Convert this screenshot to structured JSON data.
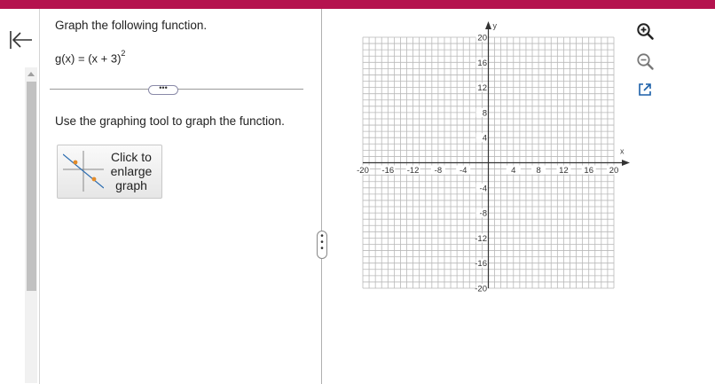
{
  "colors": {
    "topbar": "#b5124e",
    "accent": "#1a5fa8",
    "grid": "#b9b9b9",
    "axis": "#333333"
  },
  "question": {
    "title": "Graph the following function.",
    "function_lhs": "g(x) = (x + 3)",
    "function_exponent": "2",
    "instruction": "Use the graphing tool to graph the function.",
    "more_label": "•••",
    "enlarge_label_lines": [
      "Click to",
      "enlarge",
      "graph"
    ]
  },
  "graph": {
    "x_axis_label": "x",
    "y_axis_label": "y",
    "x_range": [
      -20,
      20
    ],
    "y_range": [
      -20,
      20
    ],
    "grid_step": 1,
    "x_tick_labels": [
      "-20",
      "-16",
      "-12",
      "-8",
      "-4",
      "4",
      "8",
      "12",
      "16",
      "20"
    ],
    "y_tick_labels": [
      "20",
      "16",
      "12",
      "8",
      "4",
      "-4",
      "-8",
      "-12",
      "-16",
      "-20"
    ]
  },
  "tools": {
    "zoom_in_icon": "zoom-in-icon",
    "zoom_out_icon": "zoom-out-icon",
    "popout_icon": "external-link-icon"
  },
  "icons": {
    "back": "arrow-left-to-bar-icon",
    "resize": "drag-handle-icon"
  }
}
